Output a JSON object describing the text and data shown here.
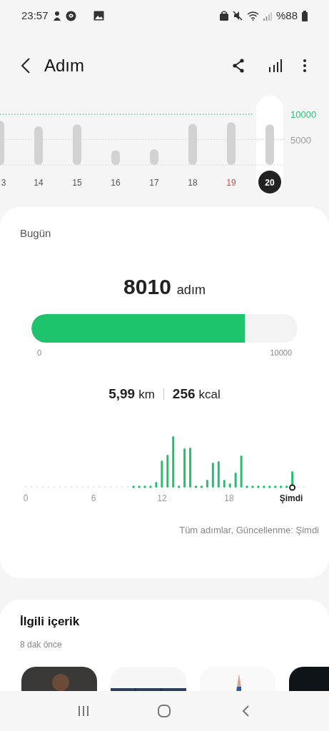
{
  "status_bar": {
    "time": "23:57",
    "battery": "%88"
  },
  "header": {
    "title": "Adım"
  },
  "week_chart": {
    "chart_data": {
      "type": "bar",
      "categories": [
        "3",
        "14",
        "15",
        "16",
        "17",
        "18",
        "19",
        "20"
      ],
      "values": [
        8700,
        7600,
        8000,
        2900,
        3100,
        8100,
        8400,
        8000
      ],
      "ylim": [
        0,
        10000
      ],
      "yticks": [
        {
          "value": 10000,
          "label": "10000"
        },
        {
          "value": 5000,
          "label": "5000"
        }
      ]
    },
    "days": [
      {
        "selected": false,
        "color": "#555555"
      },
      {
        "selected": false,
        "color": "#555555"
      },
      {
        "selected": false,
        "color": "#555555"
      },
      {
        "selected": false,
        "color": "#555555"
      },
      {
        "selected": false,
        "color": "#555555"
      },
      {
        "selected": false,
        "color": "#555555"
      },
      {
        "selected": false,
        "color": "#e0454f"
      },
      {
        "selected": true,
        "color": "#ffffff"
      }
    ]
  },
  "today": {
    "heading": "Bugün",
    "steps": "8010",
    "unit": "adım",
    "level": 0.801,
    "min_label": "0",
    "max_label": "10000",
    "distance": "5,99",
    "distance_unit": "km",
    "calories": "256",
    "calories_unit": "kcal",
    "hourly_ticks": [
      "0",
      "6",
      "12",
      "18",
      "Şimdi"
    ],
    "footnote": "Tüm adımlar, Güncellenme: Şimdi"
  },
  "related": {
    "title": "İlgili içerik",
    "time": "8 dak önce"
  }
}
